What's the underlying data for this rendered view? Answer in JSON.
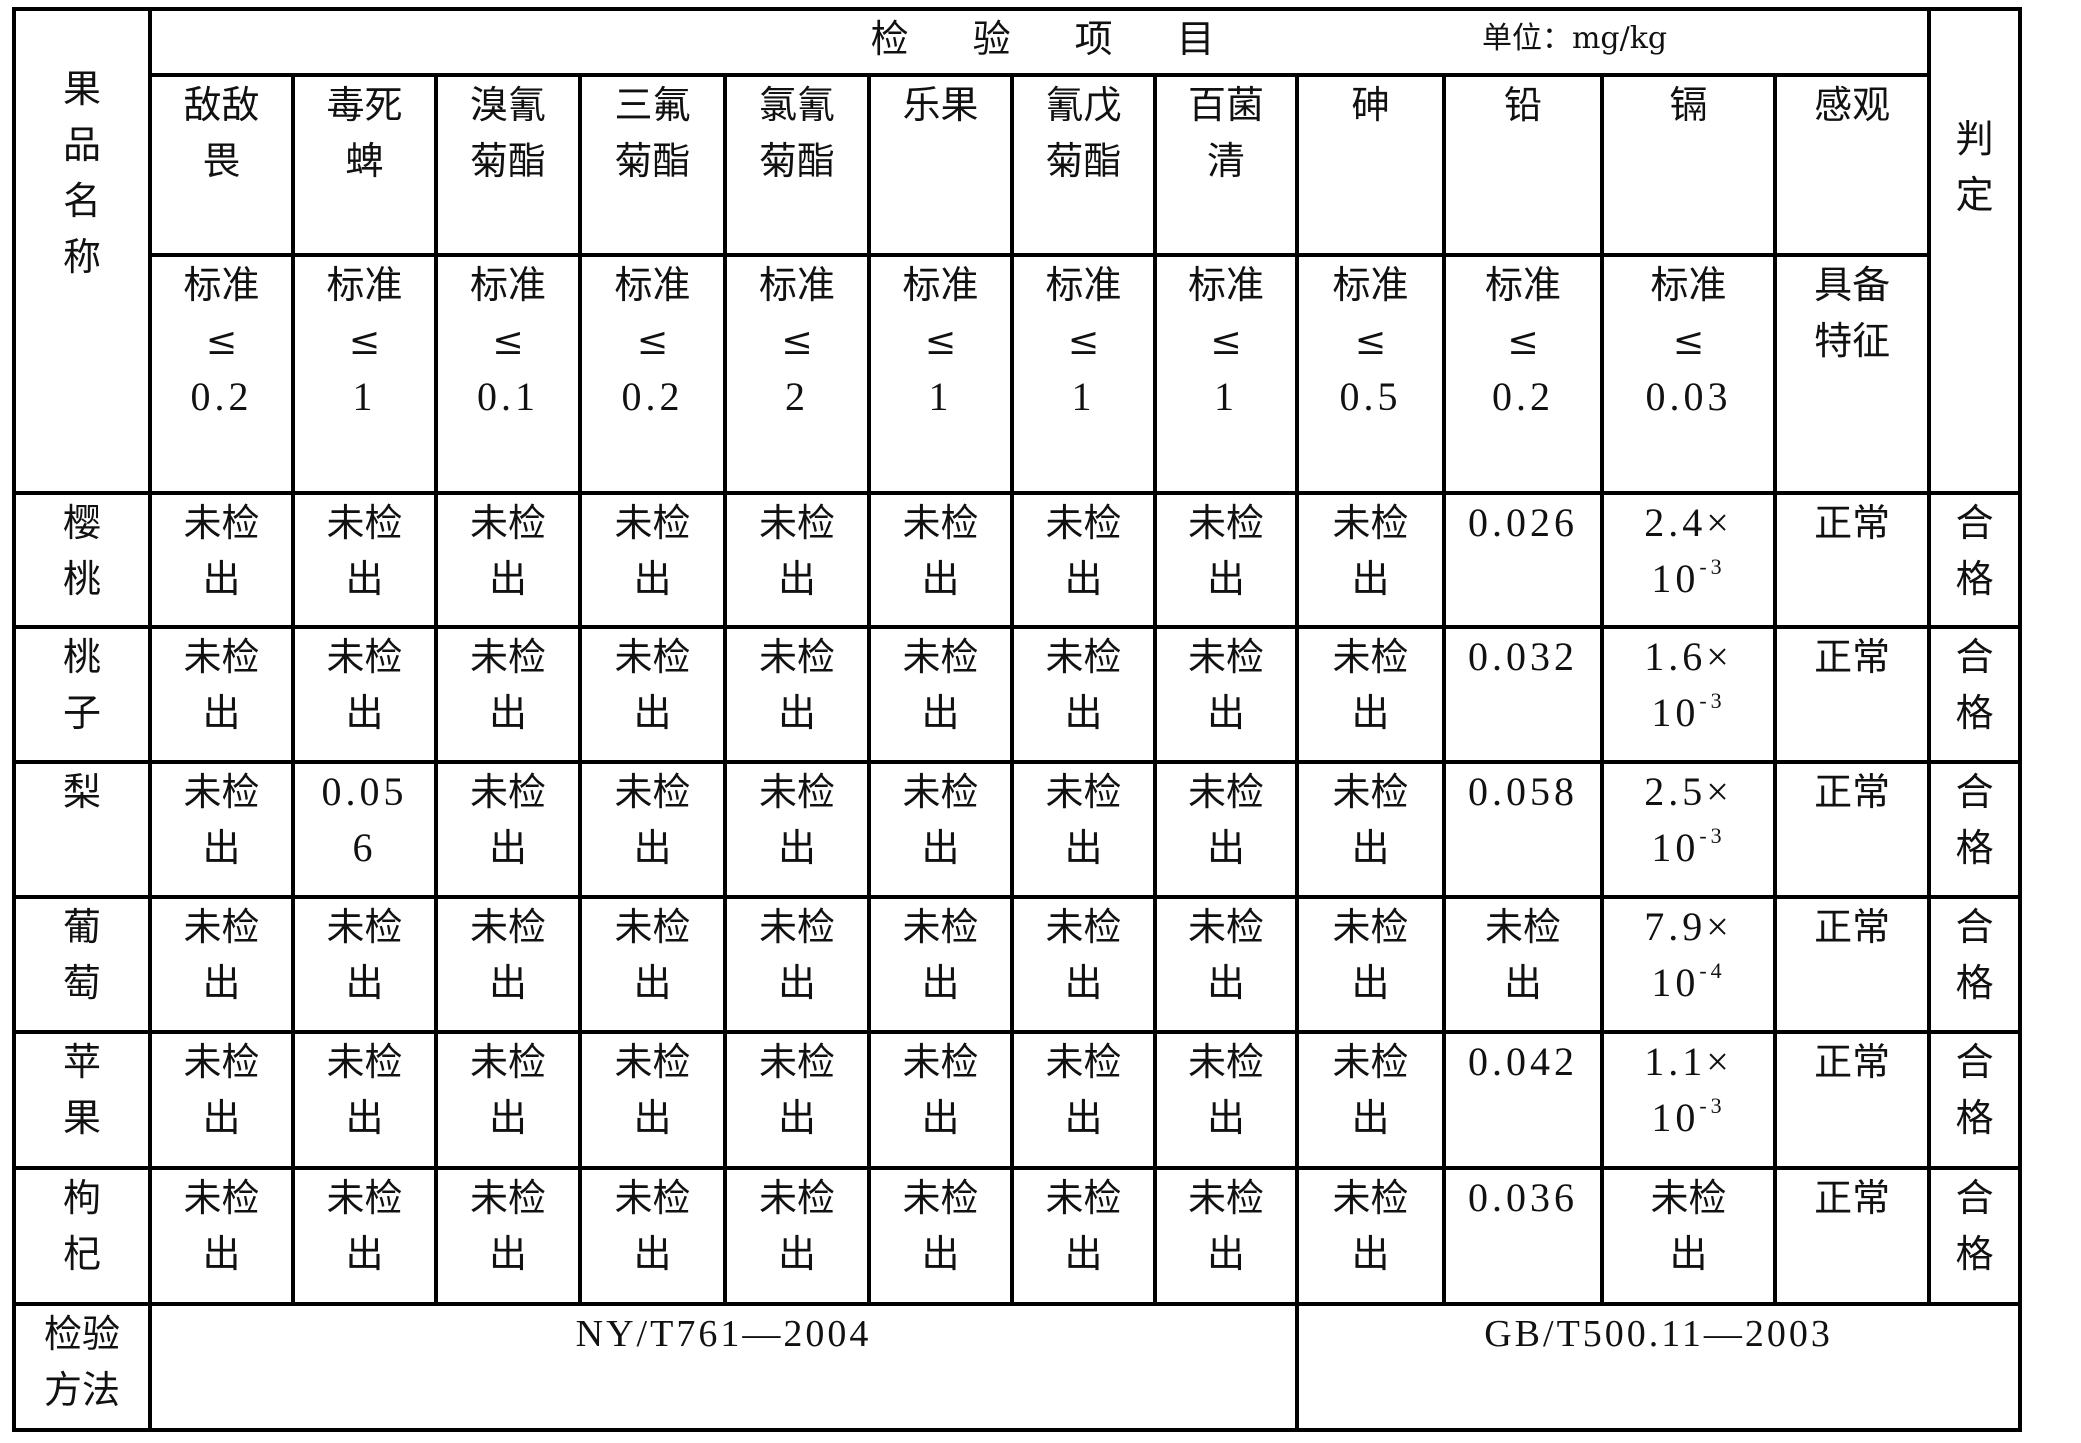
{
  "table": {
    "row_header_label": [
      "果",
      "品",
      "名",
      "称"
    ],
    "items_title": "检验项目",
    "unit_label": "单位：mg/kg",
    "judgement_label": [
      "判",
      "定"
    ],
    "items": [
      {
        "name": [
          "敌敌",
          "畏"
        ],
        "standard": [
          "标准",
          "≤",
          "0.2"
        ]
      },
      {
        "name": [
          "毒死",
          "蜱"
        ],
        "standard": [
          "标准",
          "≤",
          "1"
        ]
      },
      {
        "name": [
          "溴氰",
          "菊酯"
        ],
        "standard": [
          "标准",
          "≤",
          "0.1"
        ]
      },
      {
        "name": [
          "三氟",
          "菊酯"
        ],
        "standard": [
          "标准",
          "≤",
          "0.2"
        ]
      },
      {
        "name": [
          "氯氰",
          "菊酯"
        ],
        "standard": [
          "标准",
          "≤",
          "2"
        ]
      },
      {
        "name": [
          "乐果"
        ],
        "standard": [
          "标准",
          "≤",
          "1"
        ]
      },
      {
        "name": [
          "氰戊",
          "菊酯"
        ],
        "standard": [
          "标准",
          "≤",
          "1"
        ]
      },
      {
        "name": [
          "百菌",
          "清"
        ],
        "standard": [
          "标准",
          "≤",
          "1"
        ]
      },
      {
        "name": [
          "砷"
        ],
        "standard": [
          "标准",
          "≤",
          "0.5"
        ]
      },
      {
        "name": [
          "铅"
        ],
        "standard": [
          "标准",
          "≤",
          "0.2"
        ]
      },
      {
        "name": [
          "镉"
        ],
        "standard": [
          "标准",
          "≤",
          "0.03"
        ]
      },
      {
        "name": [
          "感观"
        ],
        "standard": [
          "具备",
          "特征"
        ]
      }
    ],
    "rows": [
      {
        "fruit": [
          "樱",
          "桃"
        ],
        "values": [
          [
            "未检",
            "出"
          ],
          [
            "未检",
            "出"
          ],
          [
            "未检",
            "出"
          ],
          [
            "未检",
            "出"
          ],
          [
            "未检",
            "出"
          ],
          [
            "未检",
            "出"
          ],
          [
            "未检",
            "出"
          ],
          [
            "未检",
            "出"
          ],
          [
            "未检",
            "出"
          ],
          [
            "0.026"
          ],
          [
            "2.4×",
            "10",
            "-3"
          ],
          [
            "正常"
          ]
        ],
        "judgement": [
          "合",
          "格"
        ]
      },
      {
        "fruit": [
          "桃",
          "子"
        ],
        "values": [
          [
            "未检",
            "出"
          ],
          [
            "未检",
            "出"
          ],
          [
            "未检",
            "出"
          ],
          [
            "未检",
            "出"
          ],
          [
            "未检",
            "出"
          ],
          [
            "未检",
            "出"
          ],
          [
            "未检",
            "出"
          ],
          [
            "未检",
            "出"
          ],
          [
            "未检",
            "出"
          ],
          [
            "0.032"
          ],
          [
            "1.6×",
            "10",
            "-3"
          ],
          [
            "正常"
          ]
        ],
        "judgement": [
          "合",
          "格"
        ]
      },
      {
        "fruit": [
          "梨"
        ],
        "values": [
          [
            "未检",
            "出"
          ],
          [
            "0.05",
            "6"
          ],
          [
            "未检",
            "出"
          ],
          [
            "未检",
            "出"
          ],
          [
            "未检",
            "出"
          ],
          [
            "未检",
            "出"
          ],
          [
            "未检",
            "出"
          ],
          [
            "未检",
            "出"
          ],
          [
            "未检",
            "出"
          ],
          [
            "0.058"
          ],
          [
            "2.5×",
            "10",
            "-3"
          ],
          [
            "正常"
          ]
        ],
        "judgement": [
          "合",
          "格"
        ]
      },
      {
        "fruit": [
          "葡",
          "萄"
        ],
        "values": [
          [
            "未检",
            "出"
          ],
          [
            "未检",
            "出"
          ],
          [
            "未检",
            "出"
          ],
          [
            "未检",
            "出"
          ],
          [
            "未检",
            "出"
          ],
          [
            "未检",
            "出"
          ],
          [
            "未检",
            "出"
          ],
          [
            "未检",
            "出"
          ],
          [
            "未检",
            "出"
          ],
          [
            "未检",
            "出"
          ],
          [
            "7.9×",
            "10",
            "-4"
          ],
          [
            "正常"
          ]
        ],
        "judgement": [
          "合",
          "格"
        ]
      },
      {
        "fruit": [
          "苹",
          "果"
        ],
        "values": [
          [
            "未检",
            "出"
          ],
          [
            "未检",
            "出"
          ],
          [
            "未检",
            "出"
          ],
          [
            "未检",
            "出"
          ],
          [
            "未检",
            "出"
          ],
          [
            "未检",
            "出"
          ],
          [
            "未检",
            "出"
          ],
          [
            "未检",
            "出"
          ],
          [
            "未检",
            "出"
          ],
          [
            "0.042"
          ],
          [
            "1.1×",
            "10",
            "-3"
          ],
          [
            "正常"
          ]
        ],
        "judgement": [
          "合",
          "格"
        ]
      },
      {
        "fruit": [
          "枸",
          "杞"
        ],
        "values": [
          [
            "未检",
            "出"
          ],
          [
            "未检",
            "出"
          ],
          [
            "未检",
            "出"
          ],
          [
            "未检",
            "出"
          ],
          [
            "未检",
            "出"
          ],
          [
            "未检",
            "出"
          ],
          [
            "未检",
            "出"
          ],
          [
            "未检",
            "出"
          ],
          [
            "未检",
            "出"
          ],
          [
            "0.036"
          ],
          [
            "未检",
            "出"
          ],
          [
            "正常"
          ]
        ],
        "judgement": [
          "合",
          "格"
        ]
      }
    ],
    "method_label": [
      "检验",
      "方法"
    ],
    "methods": [
      "NY/T761—2004",
      "GB/T500.11—2003"
    ]
  }
}
